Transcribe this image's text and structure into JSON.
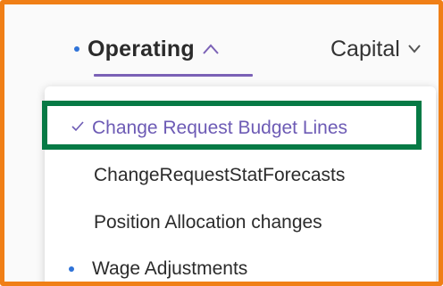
{
  "tabs": {
    "operating": {
      "label": "Operating",
      "indicator": "dot",
      "expanded": true
    },
    "capital": {
      "label": "Capital"
    }
  },
  "menu": {
    "items": [
      {
        "label": "Change Request Budget Lines",
        "selected": true,
        "icon": "check-icon"
      },
      {
        "label": "ChangeRequestStatForecasts"
      },
      {
        "label": "Position Allocation changes"
      },
      {
        "label": "Wage Adjustments",
        "indicator": "dot"
      }
    ]
  },
  "colors": {
    "accent_purple": "#7b61b6",
    "selected_text": "#6d5bb5",
    "dot_blue": "#2f73d8",
    "highlight_green": "#067a45",
    "frame_orange": "#f07f16"
  }
}
